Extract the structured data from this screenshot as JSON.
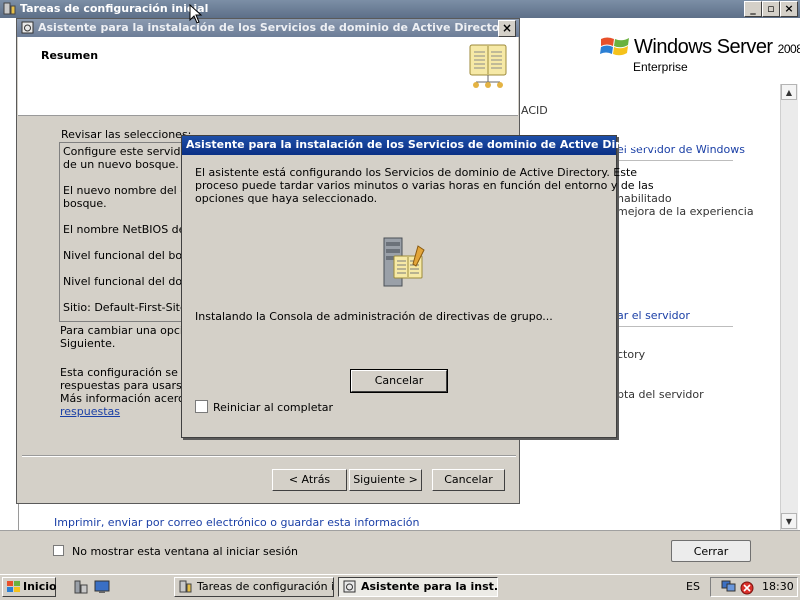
{
  "background_window": {
    "title": "Tareas de configuración inicial",
    "brand": {
      "name": "Windows Server",
      "year": "2008",
      "edition": "Enterprise"
    },
    "partial_texts": [
      "ACID",
      "el servidor de Windows",
      "nabilitado",
      "mejora de la experiencia",
      "ar el servidor",
      "ctory",
      "pta del servidor"
    ],
    "print_link": "Imprimir, enviar por correo electrónico o guardar esta información",
    "dont_show_label": "No mostrar esta ventana al iniciar sesión",
    "close_button": "Cerrar"
  },
  "wizard": {
    "title": "Asistente para la instalación de los Servicios de dominio de Active Directory",
    "heading": "Resumen",
    "review_label": "Revisar las selecciones:",
    "review_items": [
      "Configure este servidor c",
      "de un nuevo bosque.",
      "El nuevo nombre del dom",
      "bosque.",
      "El nombre NetBIOS del d",
      "Nivel funcional del bosqu",
      "Nivel funcional del domin",
      "Sitio: Default-First-Site-Na"
    ],
    "change_text": [
      "Para cambiar una opción,",
      "Siguiente."
    ],
    "config_text": [
      "Esta configuración se pue",
      "respuestas para usarse c",
      "Más información acerca d"
    ],
    "answers_link": "respuestas",
    "buttons": {
      "back": "< Atrás",
      "next": "Siguiente >",
      "cancel": "Cancelar"
    }
  },
  "progress_dialog": {
    "title": "Asistente para la instalación de los Servicios de dominio de Active Directory",
    "message_lines": [
      "El asistente está configurando los Servicios de dominio de Active Directory. Este",
      "proceso puede tardar varios minutos o varias horas en función del entorno y de las",
      "opciones que haya seleccionado."
    ],
    "status": "Instalando la Consola de administración de directivas de grupo...",
    "cancel_button": "Cancelar",
    "restart_label": "Reiniciar al completar",
    "restart_checked": false
  },
  "taskbar": {
    "start_label": "Inicio",
    "tasks": [
      {
        "label": "Tareas de configuración i...",
        "active": false
      },
      {
        "label": "Asistente para la inst...",
        "active": true
      }
    ],
    "language": "ES",
    "clock": "18:30"
  }
}
